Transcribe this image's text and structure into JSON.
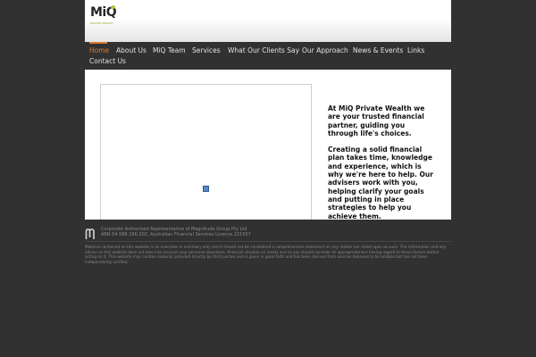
{
  "brand": {
    "logo_text": "MiQ",
    "logo_tagline": "PRIVATE WEALTH",
    "accent_color": "#e07a2c",
    "logo_dot_color": "#b7c33a"
  },
  "nav": {
    "items": [
      {
        "label": "Home",
        "active": true
      },
      {
        "label": "About Us"
      },
      {
        "label": "MiQ Team"
      },
      {
        "label": "Services"
      },
      {
        "label": "What Our Clients Say"
      },
      {
        "label": "Our Approach"
      },
      {
        "label": "News & Events"
      },
      {
        "label": "Links"
      },
      {
        "label": "Contact Us"
      }
    ]
  },
  "main": {
    "media_icon": "plugin-placeholder-icon",
    "intro_paragraph_1": "At MiQ Private Wealth we are your trusted financial partner, guiding you through life's choices.",
    "intro_paragraph_2": "Creating a solid financial plan takes time, knowledge and experience, which is why we're here to help. Our advisers work with you, helping clarify your goals and putting in place strategies to help you achieve them."
  },
  "footer": {
    "logo_icon": "magnitude-logo-icon",
    "credit_line_1": "Corporate Authorised Representative of Magnitude Group Pty Ltd",
    "credit_line_2": "ABN 54 086 266 202, Australian Financial Services Licence 221557",
    "disclaimer": "Material contained on this website is an overview or summary only and it should not be considered a comprehensive statement on any matter nor relied upon as such. The information and any advice on this website does not take into account your personal objectives, financial situation or needs and so you should consider its appropriateness having regard to these factors before acting on it. This website may contain material provided directly by third parties and is given in good faith and has been derived from sources believed to be reliable but has not been independently verified."
  }
}
